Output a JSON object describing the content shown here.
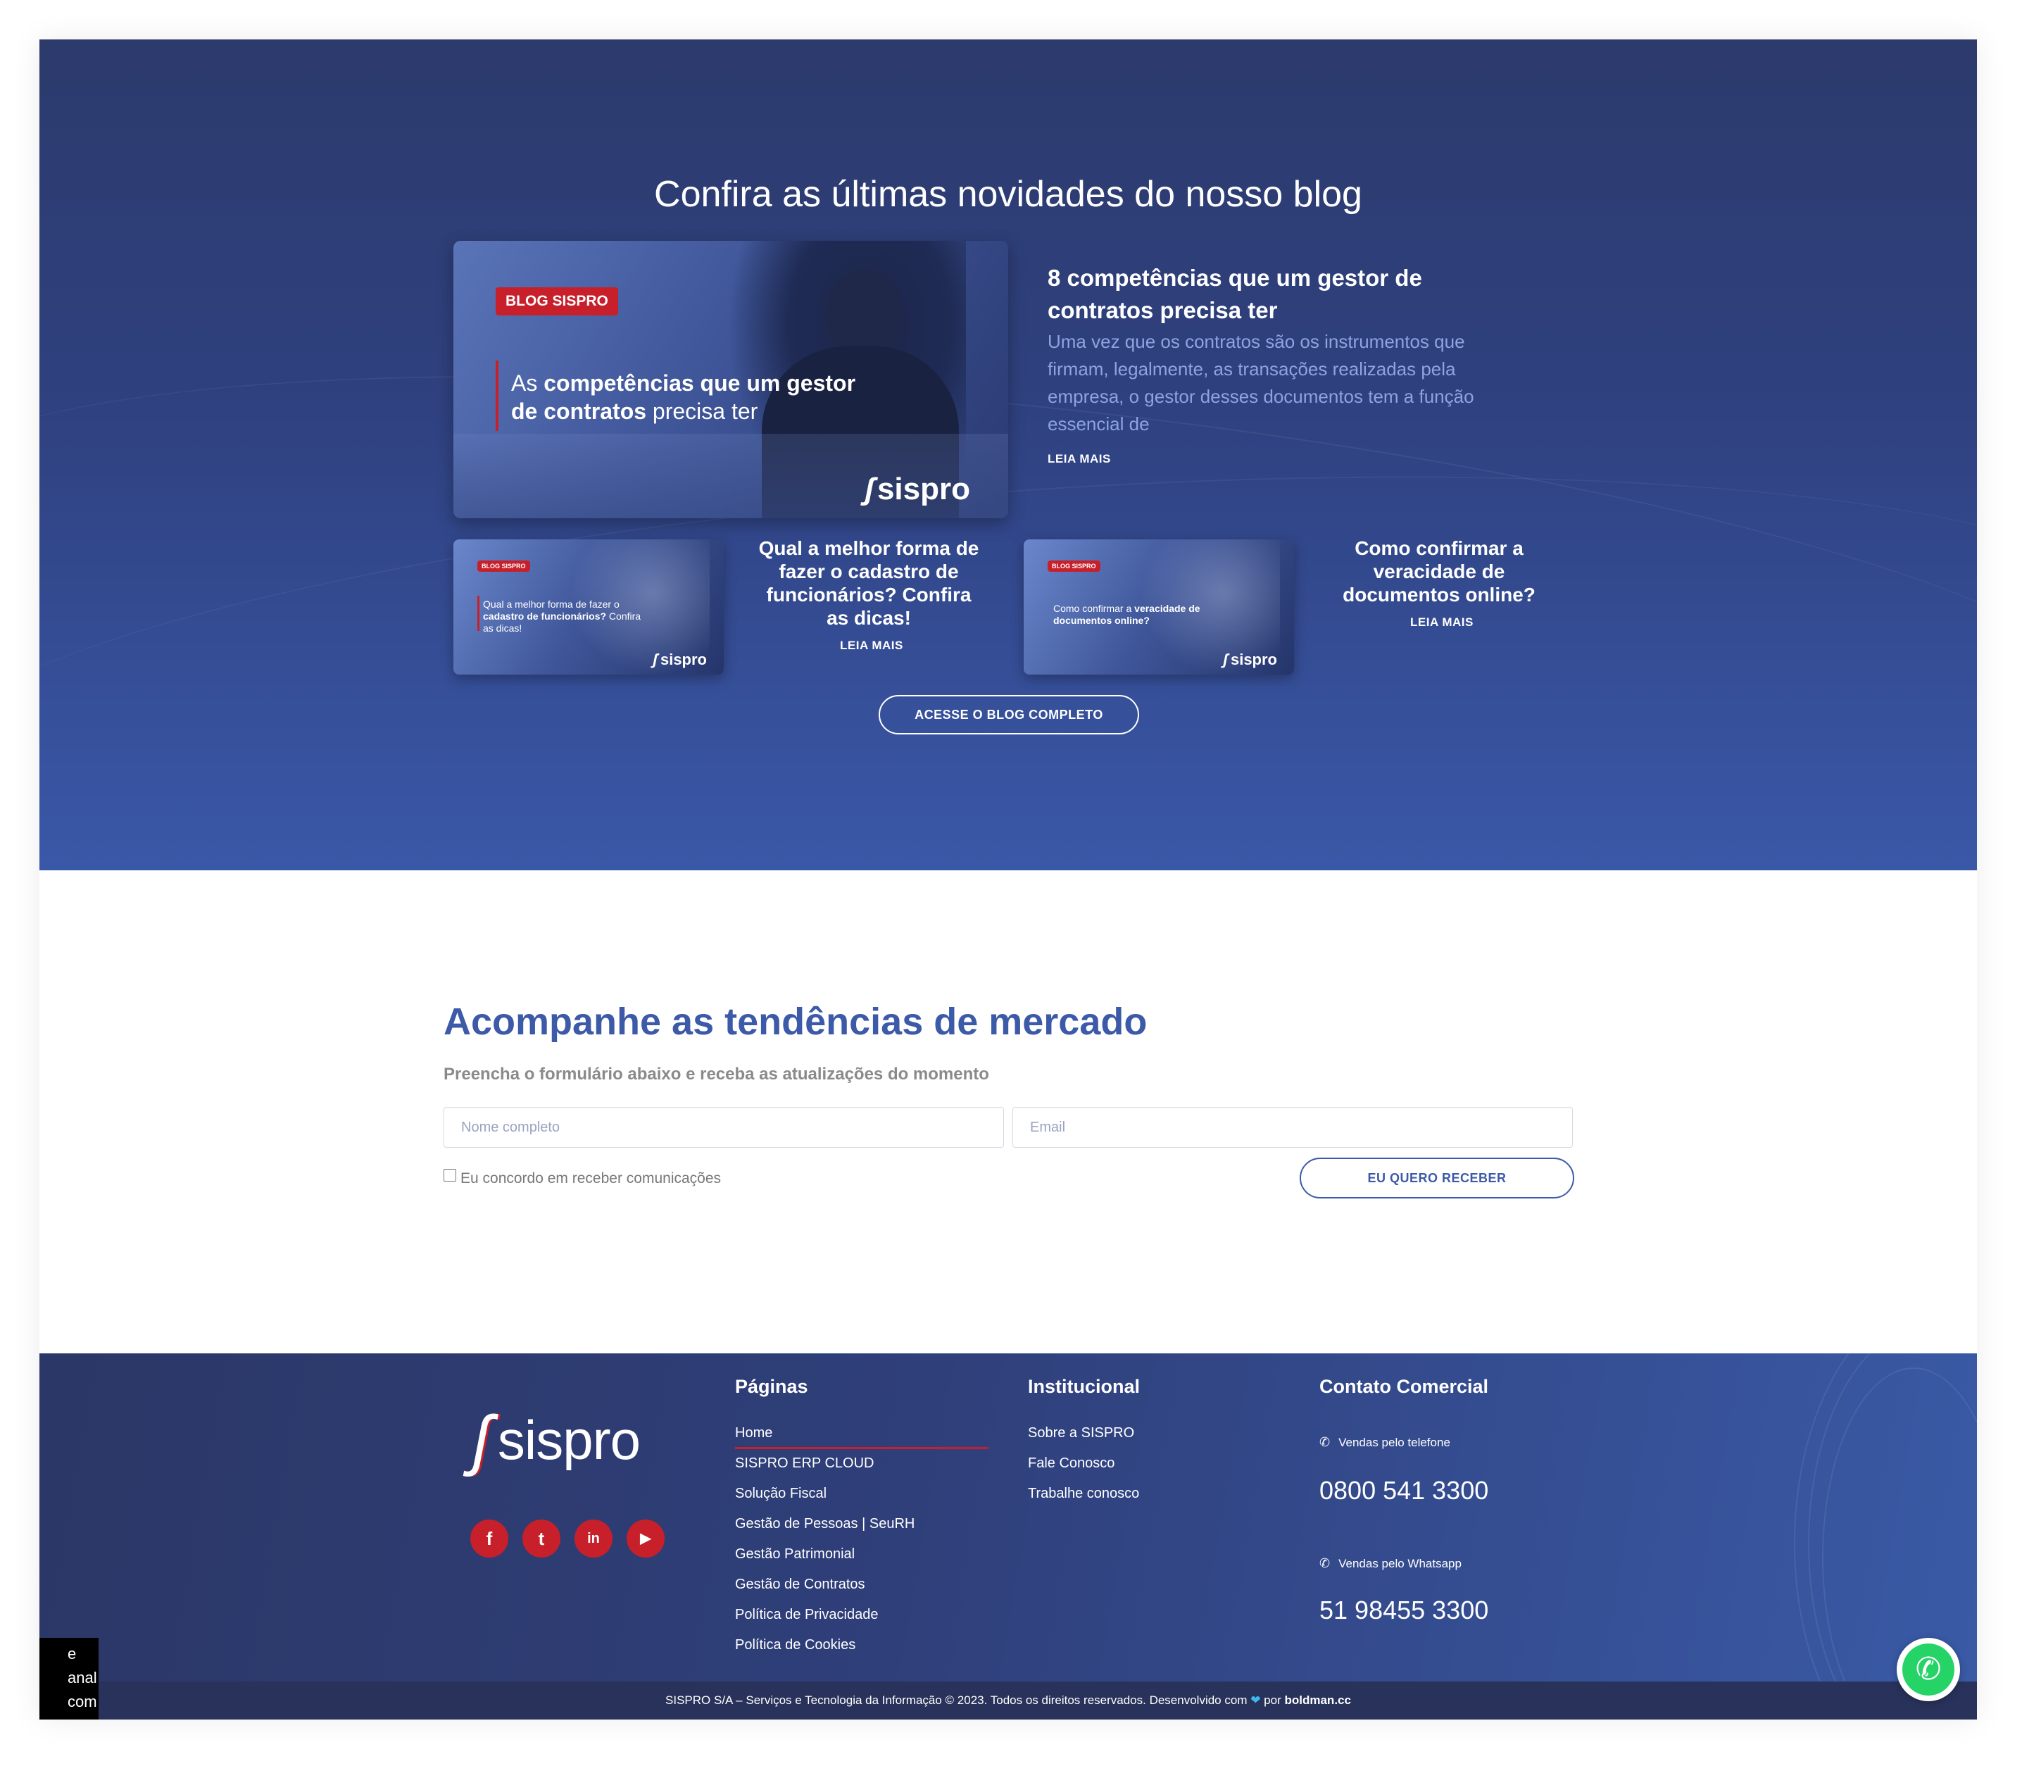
{
  "blog": {
    "title": "Confira as últimas novidades do nosso blog",
    "featured": {
      "badge": "BLOG SISPRO",
      "image_text_pre": "As ",
      "image_text_bold1": "competências que um gestor de contratos",
      "image_text_post": " precisa ter",
      "image_logo": "sispro",
      "title": "8 competências que um gestor de contratos precisa ter",
      "excerpt": "Uma vez que os contratos são os instrumentos que firmam, legalmente, as transações realizadas pela empresa, o gestor desses documentos tem a função essencial de",
      "read_more": "LEIA MAIS"
    },
    "posts": [
      {
        "badge": "BLOG SISPRO",
        "image_text_pre": "Qual a melhor forma de fazer o ",
        "image_text_bold": "cadastro de funcionários?",
        "image_text_post": " Confira as dicas!",
        "image_logo": "sispro",
        "title": "Qual a melhor forma de fazer o cadastro de funcionários? Confira as dicas!",
        "read_more": "LEIA MAIS"
      },
      {
        "badge": "BLOG SISPRO",
        "image_text_pre": "Como confirmar a ",
        "image_text_bold": "veracidade de documentos online?",
        "image_text_post": "",
        "image_logo": "sispro",
        "title": "Como confirmar a veracidade de documentos online?",
        "read_more": "LEIA MAIS"
      }
    ],
    "cta": "ACESSE O BLOG COMPLETO"
  },
  "newsletter": {
    "title": "Acompanhe as tendências de mercado",
    "subtitle": "Preencha o formulário abaixo e receba as atualizações do momento",
    "name_placeholder": "Nome completo",
    "email_placeholder": "Email",
    "consent_label": "Eu concordo em receber comunicações",
    "submit": "EU QUERO RECEBER"
  },
  "footer": {
    "logo": "sispro",
    "social": [
      {
        "icon": "facebook-icon",
        "glyph": "f"
      },
      {
        "icon": "twitter-icon",
        "glyph": "t"
      },
      {
        "icon": "linkedin-icon",
        "glyph": "in"
      },
      {
        "icon": "youtube-icon",
        "glyph": "▶"
      }
    ],
    "pages_title": "Páginas",
    "pages": [
      "Home",
      "SISPRO ERP CLOUD",
      "Solução Fiscal",
      "Gestão de Pessoas | SeuRH",
      "Gestão Patrimonial",
      "Gestão de Contratos",
      "Política de Privacidade",
      "Política de Cookies"
    ],
    "institutional_title": "Institucional",
    "institutional": [
      "Sobre a SISPRO",
      "Fale Conosco",
      "Trabalhe conosco"
    ],
    "contact_title": "Contato Comercial",
    "phone_label": "Vendas pelo telefone",
    "phone_number": "0800 541 3300",
    "whatsapp_label": "Vendas pelo Whatsapp",
    "whatsapp_number": "51 98455 3300",
    "copyright_pre": "SISPRO S/A – Serviços e Tecnologia da Informação © 2023. Todos os direitos reservados. Desenvolvido com ",
    "copyright_mid": " por ",
    "copyright_brand": "boldman.cc"
  },
  "overlay_text": [
    "e",
    "anal",
    "com"
  ],
  "colors": {
    "accent_red": "#c8202a",
    "brand_blue": "#3d5aa8",
    "whatsapp_green": "#25d366"
  }
}
